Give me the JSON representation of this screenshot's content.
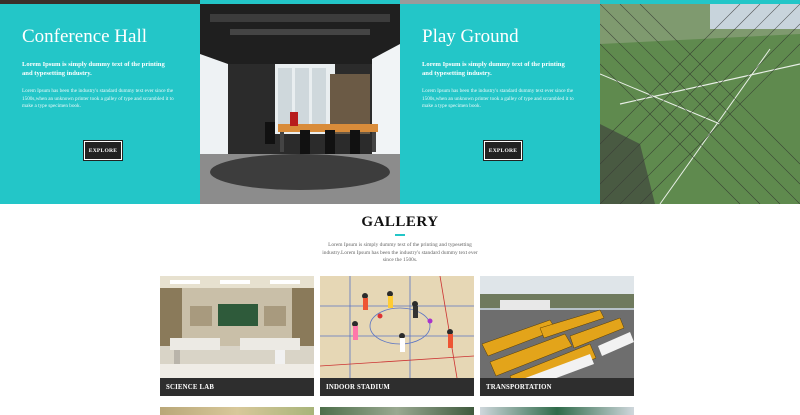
{
  "facilities": [
    {
      "title": "Conference Hall",
      "lead": "Lorem Ipsum is simply dummy text of the printing and typesetting industry.",
      "description": "Lorem Ipsum has been the industry's standard dummy text ever since the 1500s,when an unknown printer took a galley of type and scrambled it to make a type specimen book.",
      "button": "EXPLORE"
    },
    {
      "title": "Play Ground",
      "lead": "Lorem Ipsum is simply dummy text of the printing and typesetting industry.",
      "description": "Lorem Ipsum has been the industry's standard dummy text ever since the 1500s,when an unknown printer took a galley of type and scrambled it to make a type specimen book.",
      "button": "EXPLORE"
    }
  ],
  "gallery": {
    "title": "GALLERY",
    "description": "Lorem Ipsum is simply dummy text of the printing and typesetting industry.Lorem Ipsum has been the industry's standard dummy text ever since the 1500s.",
    "items": [
      {
        "caption": "SCIENCE LAB"
      },
      {
        "caption": "INDOOR STADIUM"
      },
      {
        "caption": "TRANSPORTATION"
      }
    ]
  },
  "colors": {
    "accent": "#23c6c8",
    "caption_bg": "#2e2e2e",
    "button_bg": "#222222"
  },
  "icons": [
    "conference-hall-photo",
    "playground-photo",
    "science-lab-photo",
    "indoor-stadium-photo",
    "transportation-photo"
  ]
}
